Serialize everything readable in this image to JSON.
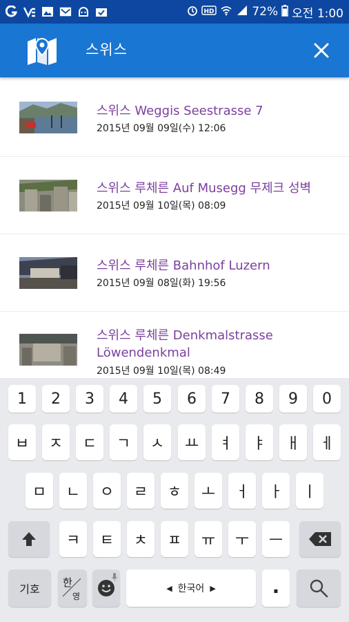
{
  "status_bar": {
    "battery": "72%",
    "time": "오전 1:00",
    "icons": [
      "g-icon",
      "v-icon",
      "image-icon",
      "mail-icon",
      "android-icon",
      "check-bag-icon",
      "alarm-icon",
      "hd-icon",
      "wifi-icon",
      "signal-icon",
      "battery-icon"
    ]
  },
  "app_bar": {
    "title": "스위스",
    "icons": [
      "map-icon",
      "close-icon"
    ]
  },
  "list": {
    "items": [
      {
        "title": "스위스 Weggis Seestrasse 7",
        "date": "2015년 09월 09일(수) 12:06"
      },
      {
        "title": "스위스 루체른 Auf Musegg 무제크 성벽",
        "date": "2015년 09월 10일(목) 08:09"
      },
      {
        "title": "스위스 루체른 Bahnhof Luzern",
        "date": "2015년 09월 08일(화) 19:56"
      },
      {
        "title": "스위스 루체른 Denkmalstrasse Löwendenkmal",
        "date": "2015년 09월 10일(목) 08:49"
      }
    ]
  },
  "keyboard": {
    "row1": [
      "1",
      "2",
      "3",
      "4",
      "5",
      "6",
      "7",
      "8",
      "9",
      "0"
    ],
    "row2": [
      "ㅂ",
      "ㅈ",
      "ㄷ",
      "ㄱ",
      "ㅅ",
      "ㅛ",
      "ㅕ",
      "ㅑ",
      "ㅐ",
      "ㅔ"
    ],
    "row3": [
      "ㅁ",
      "ㄴ",
      "ㅇ",
      "ㄹ",
      "ㅎ",
      "ㅗ",
      "ㅓ",
      "ㅏ",
      "ㅣ"
    ],
    "row4": [
      "ㅋ",
      "ㅌ",
      "ㅊ",
      "ㅍ",
      "ㅠ",
      "ㅜ",
      "ㅡ"
    ],
    "symbol_key": "기호",
    "lang_key_top": "한",
    "lang_key_bottom": "영",
    "space_label": "한국어",
    "period": ".",
    "icons": [
      "shift-icon",
      "backspace-icon",
      "emoji-icon",
      "mic-icon",
      "search-icon"
    ]
  }
}
